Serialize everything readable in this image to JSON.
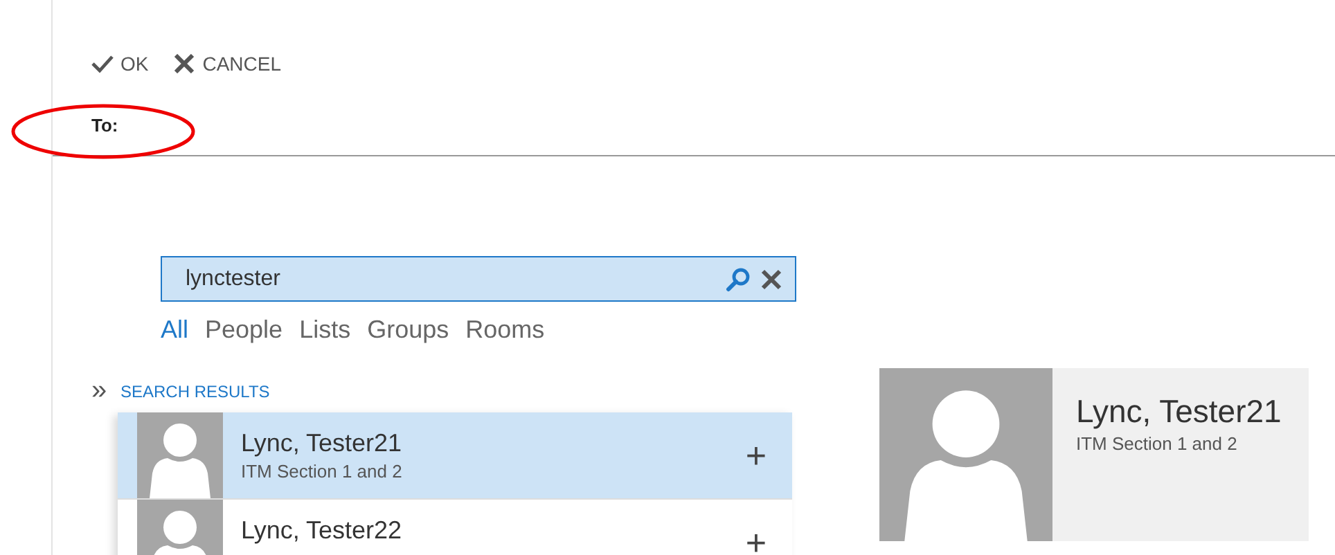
{
  "toolbar": {
    "buttons": [
      {
        "kind": "ok",
        "label": "OK"
      },
      {
        "kind": "cancel",
        "label": "CANCEL"
      }
    ]
  },
  "to_field": {
    "label": "To:",
    "annotated": true
  },
  "search": {
    "value": "lynctester"
  },
  "filters": [
    {
      "label": "All",
      "selected": true
    },
    {
      "label": "People",
      "selected": false
    },
    {
      "label": "Lists",
      "selected": false
    },
    {
      "label": "Groups",
      "selected": false
    },
    {
      "label": "Rooms",
      "selected": false
    }
  ],
  "expand_toggle": "»",
  "results": {
    "heading": "SEARCH RESULTS",
    "items": [
      {
        "name": "Lync, Tester21",
        "detail": "ITM Section 1 and 2",
        "add": "+",
        "selected": true
      },
      {
        "name": "Lync, Tester22",
        "add": "+",
        "selected": false
      }
    ]
  },
  "contact_card": {
    "name": "Lync, Tester21",
    "detail": "ITM Section 1 and 2"
  }
}
